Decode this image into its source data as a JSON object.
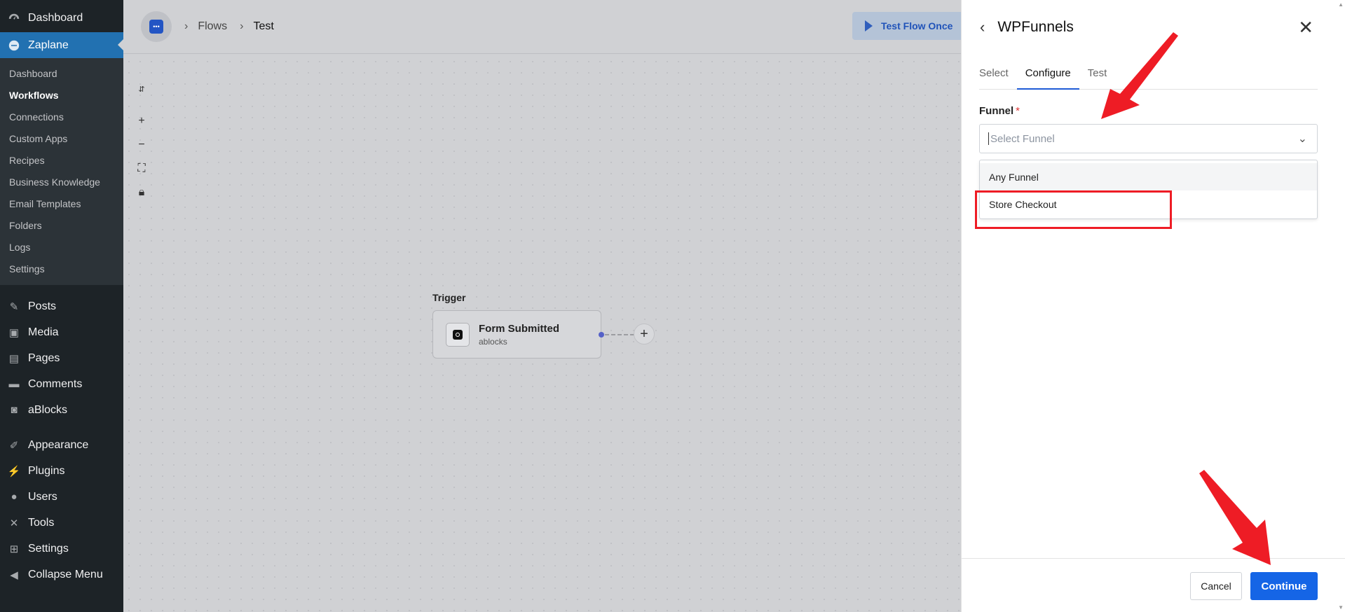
{
  "wp_sidebar": {
    "dashboard_label": "Dashboard",
    "zaplane_label": "Zaplane",
    "submenu": [
      {
        "label": "Dashboard",
        "current": false
      },
      {
        "label": "Workflows",
        "current": true
      },
      {
        "label": "Connections",
        "current": false
      },
      {
        "label": "Custom Apps",
        "current": false
      },
      {
        "label": "Recipes",
        "current": false
      },
      {
        "label": "Business Knowledge",
        "current": false
      },
      {
        "label": "Email Templates",
        "current": false
      },
      {
        "label": "Folders",
        "current": false
      },
      {
        "label": "Logs",
        "current": false
      },
      {
        "label": "Settings",
        "current": false
      }
    ],
    "menu": [
      {
        "label": "Posts",
        "icon": "pin-icon"
      },
      {
        "label": "Media",
        "icon": "media-icon"
      },
      {
        "label": "Pages",
        "icon": "pages-icon"
      },
      {
        "label": "Comments",
        "icon": "comments-icon"
      },
      {
        "label": "aBlocks",
        "icon": "ablocks-icon"
      },
      {
        "label": "Appearance",
        "icon": "brush-icon"
      },
      {
        "label": "Plugins",
        "icon": "plugin-icon"
      },
      {
        "label": "Users",
        "icon": "user-icon"
      },
      {
        "label": "Tools",
        "icon": "wrench-icon"
      },
      {
        "label": "Settings",
        "icon": "settings-icon"
      },
      {
        "label": "Collapse Menu",
        "icon": "collapse-icon"
      }
    ]
  },
  "header": {
    "breadcrumb": [
      "Flows",
      "Test"
    ],
    "test_button_label": "Test Flow Once"
  },
  "canvas": {
    "trigger_label": "Trigger",
    "trigger_title": "Form Submitted",
    "trigger_subtitle": "ablocks"
  },
  "panel": {
    "title": "WPFunnels",
    "tabs": [
      {
        "label": "Select",
        "active": false
      },
      {
        "label": "Configure",
        "active": true
      },
      {
        "label": "Test",
        "active": false
      }
    ],
    "field_label": "Funnel",
    "required_mark": "*",
    "select_placeholder": "Select Funnel",
    "options": [
      "Any Funnel",
      "Store Checkout"
    ],
    "cancel_label": "Cancel",
    "continue_label": "Continue"
  },
  "colors": {
    "wp_sidebar_bg": "#1d2327",
    "wp_active": "#2271b1",
    "accent": "#1565e6",
    "annotation_red": "#ee1c25"
  }
}
